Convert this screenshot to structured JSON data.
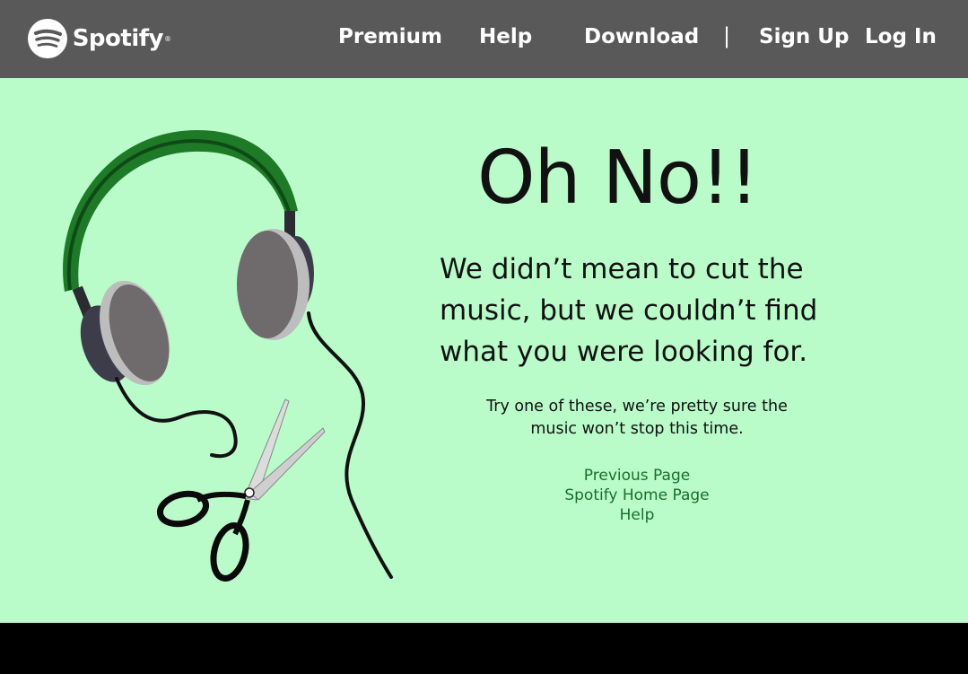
{
  "header": {
    "brand": "Spotify",
    "brand_mark": "®",
    "logo_icon": "spotify-logo-icon",
    "nav": [
      "Premium",
      "Help",
      "Download"
    ],
    "separator": "|",
    "account": [
      "Sign Up",
      "Log In"
    ]
  },
  "error": {
    "title": "Oh No!!",
    "message_lines": [
      "We didn’t mean to cut the",
      "music, but we couldn’t find",
      "what you were looking for."
    ],
    "suggestion_lines": [
      "Try one of these, we’re pretty sure the",
      "music won’t stop this time."
    ],
    "links": [
      "Previous Page",
      "Spotify Home Page",
      "Help"
    ]
  },
  "illustration": {
    "icons": [
      "headphones-icon",
      "scissors-icon"
    ],
    "colors": {
      "background": "#b9fcc9",
      "headband": "#1e7a26",
      "ear_pad": "#6f6a6c",
      "ear_cup": "#3c3c4a",
      "link": "#1a6e2e"
    }
  }
}
